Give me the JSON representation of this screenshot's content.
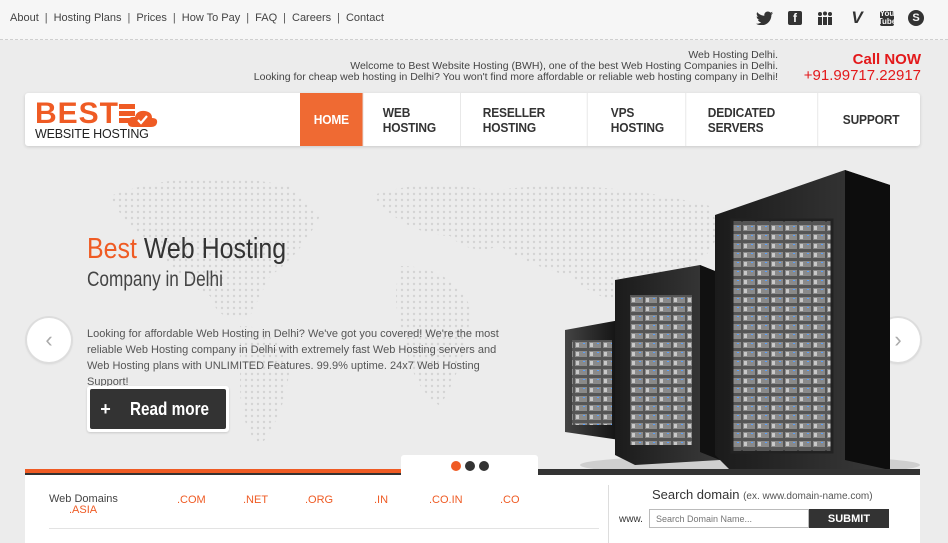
{
  "topbar": {
    "links": [
      "About",
      "Hosting Plans",
      "Prices",
      "How To Pay",
      "FAQ",
      "Careers",
      "Contact"
    ],
    "separator": "|",
    "social_icons": [
      "twitter-icon",
      "facebook-icon",
      "myspace-icon",
      "vimeo-icon",
      "youtube-icon",
      "skype-icon"
    ]
  },
  "welcome": {
    "line1": "Web Hosting Delhi.",
    "line2": "Welcome to Best Website Hosting (BWH), one of the best Web Hosting Companies in Delhi.",
    "line3": "Looking for cheap web hosting in Delhi? You won't find more affordable or reliable web hosting company in Delhi!"
  },
  "call": {
    "label": "Call NOW",
    "number": "+91.99717.22917"
  },
  "logo": {
    "main": "BEST",
    "sub": "WEBSITE HOSTING"
  },
  "nav": {
    "items": [
      {
        "label": "HOME",
        "active": true
      },
      {
        "label": "WEB HOSTING"
      },
      {
        "label": "RESELLER HOSTING"
      },
      {
        "label": "VPS HOSTING"
      },
      {
        "label": "DEDICATED SERVERS"
      },
      {
        "label": "SUPPORT"
      }
    ]
  },
  "hero": {
    "title_orange": "Best",
    "title_rest": " Web Hosting",
    "subtitle": "Company in Delhi",
    "text": "Looking for affordable Web Hosting in Delhi? We've got you covered! We're the most reliable Web Hosting company in Delhi with extremely fast Web Hosting servers and Web Hosting plans with UNLIMITED Features. 99.9% uptime. 24x7 Web Hosting Support!",
    "button_icon": "+",
    "button_label": "Read more",
    "prev_symbol": "‹",
    "next_symbol": "›"
  },
  "domains": {
    "label": "Web Domains",
    "extensions": [
      ".COM",
      ".NET",
      ".ORG",
      ".IN",
      ".CO.IN",
      ".CO"
    ],
    "extra": ".ASIA"
  },
  "search": {
    "title": "Search domain",
    "example": "(ex. www.domain-name.com)",
    "prefix": "www.",
    "placeholder": "Search Domain Name...",
    "submit": "SUBMIT"
  },
  "colors": {
    "accent": "#ef5b24",
    "dark": "#333333",
    "call": "#e3191b"
  }
}
